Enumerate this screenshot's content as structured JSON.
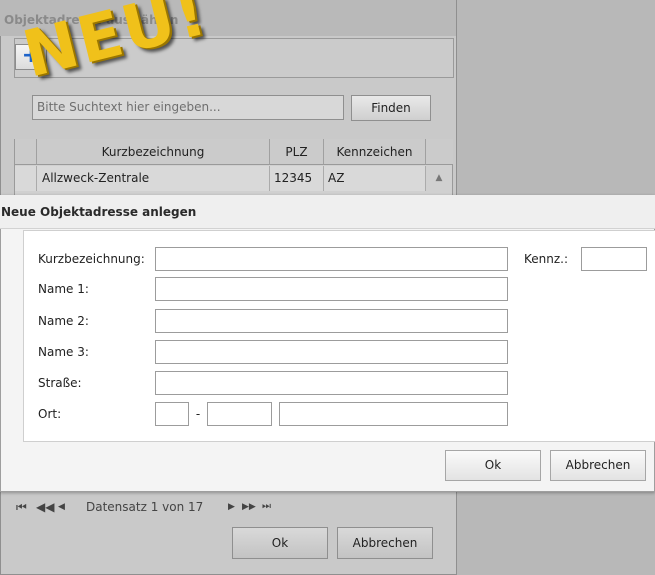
{
  "background_dialog": {
    "title": "Objektadresse auswählen",
    "search_placeholder": "Bitte Suchtext hier eingeben...",
    "find_label": "Finden",
    "columns": [
      "Kurzbezeichnung",
      "PLZ",
      "Kennzeichen"
    ],
    "rows": [
      {
        "kurz": "Allzweck-Zentrale",
        "plz": "12345",
        "kz": "AZ"
      }
    ],
    "pager_text": "Datensatz 1 von 17",
    "ok_label": "Ok",
    "cancel_label": "Abbrechen"
  },
  "badge": {
    "text": "NEU!"
  },
  "dialog": {
    "title": "Neue Objektadresse anlegen",
    "labels": {
      "kurzbezeichnung": "Kurzbezeichnung:",
      "kennz": "Kennz.:",
      "name1": "Name 1:",
      "name2": "Name 2:",
      "name3": "Name 3:",
      "strasse": "Straße:",
      "ort": "Ort:"
    },
    "separator": "-",
    "ok_label": "Ok",
    "cancel_label": "Abbrechen"
  },
  "colors": {
    "badge_yellow": "#f0c11a",
    "plus_blue": "#1d63c9"
  },
  "icons": [
    "plus-icon",
    "first-page-icon",
    "prev-page-fast-icon",
    "prev-page-icon",
    "next-page-icon",
    "next-page-fast-icon",
    "last-page-icon",
    "scroll-up-icon"
  ]
}
